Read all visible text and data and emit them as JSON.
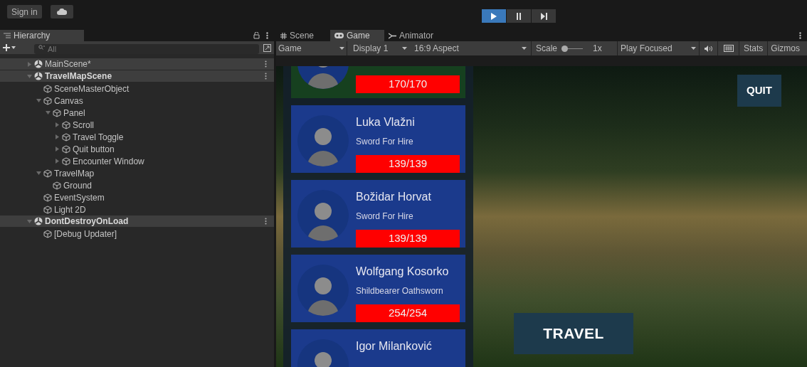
{
  "top_bar": {
    "sign_in": "Sign in",
    "play_controls": [
      {
        "kind": "play",
        "selected": true
      },
      {
        "kind": "pause",
        "selected": false
      },
      {
        "kind": "step",
        "selected": false
      }
    ]
  },
  "hierarchy": {
    "title": "Hierarchy",
    "search": {
      "placeholder": "All"
    },
    "items": [
      {
        "label": "MainScene*",
        "kind": "scene",
        "expanded": false
      },
      {
        "label": "TravelMapScene",
        "kind": "scene",
        "expanded": true,
        "children": [
          {
            "label": "SceneMasterObject",
            "kind": "object"
          },
          {
            "label": "Canvas",
            "kind": "object",
            "expanded": true,
            "children": [
              {
                "label": "Panel",
                "kind": "object",
                "expanded": true,
                "children": [
                  {
                    "label": "Scroll",
                    "kind": "object",
                    "expanded": false
                  },
                  {
                    "label": "Travel Toggle",
                    "kind": "object",
                    "expanded": false
                  },
                  {
                    "label": "Quit button",
                    "kind": "object",
                    "expanded": false
                  },
                  {
                    "label": "Encounter Window",
                    "kind": "object",
                    "expanded": false
                  }
                ]
              }
            ]
          },
          {
            "label": "TravelMap",
            "kind": "object",
            "expanded": true,
            "children": [
              {
                "label": "Ground",
                "kind": "object"
              }
            ]
          },
          {
            "label": "EventSystem",
            "kind": "object"
          },
          {
            "label": "Light 2D",
            "kind": "object"
          }
        ]
      },
      {
        "label": "DontDestroyOnLoad",
        "kind": "scene",
        "expanded": true,
        "children": [
          {
            "label": "[Debug Updater]",
            "kind": "object"
          }
        ]
      }
    ]
  },
  "view_tabs": [
    {
      "label": "Scene",
      "kind": "scene",
      "selected": false
    },
    {
      "label": "Game",
      "kind": "game",
      "selected": true
    },
    {
      "label": "Animator",
      "kind": "animator",
      "selected": false
    }
  ],
  "game_toolbar": {
    "game_dropdown": "Game",
    "display_dropdown": "Display 1",
    "aspect_dropdown": "16:9 Aspect",
    "scale_label": "Scale",
    "scale": {
      "level": 0
    },
    "scale_value": "1x",
    "play_mode_dropdown": "Play Focused",
    "stats": "Stats",
    "gizmos": "Gizmos"
  },
  "game": {
    "party": [
      {
        "hp": "170/170",
        "level": 1,
        "color": "#16401f"
      },
      {
        "name": "Luka Vlažni",
        "class": "Sword For Hire",
        "hp": "139/139",
        "level": 1,
        "color": "#1b3a8c"
      },
      {
        "name": "Božidar Horvat",
        "class": "Sword For Hire",
        "hp": "139/139",
        "level": 1,
        "color": "#1b3a8c"
      },
      {
        "name": "Wolfgang Kosorko",
        "class": "Shildbearer Oathsworn",
        "hp": "254/254",
        "level": 1,
        "color": "#1b3a8c"
      },
      {
        "name": "Igor Milanković",
        "color": "#1b3a8c"
      }
    ],
    "quit": "QUIT",
    "travel": "TRAVEL"
  }
}
